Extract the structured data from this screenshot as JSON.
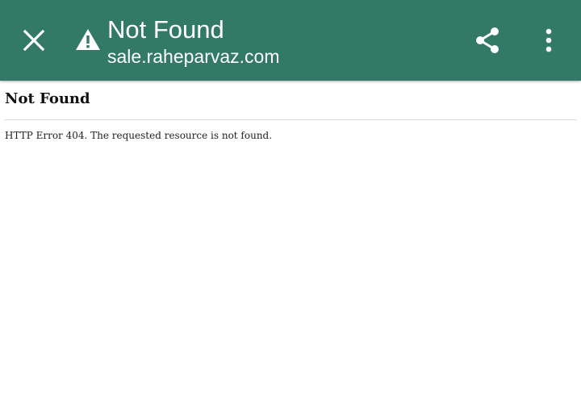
{
  "toolbar": {
    "title": "Not Found",
    "url": "sale.raheparvaz.com",
    "background": "#327a66",
    "close_icon": "close-icon",
    "warning_icon": "warning-icon",
    "share_icon": "share-icon",
    "menu_icon": "more-vert-icon"
  },
  "page": {
    "heading": "Not Found",
    "message": "HTTP Error 404. The requested resource is not found."
  }
}
